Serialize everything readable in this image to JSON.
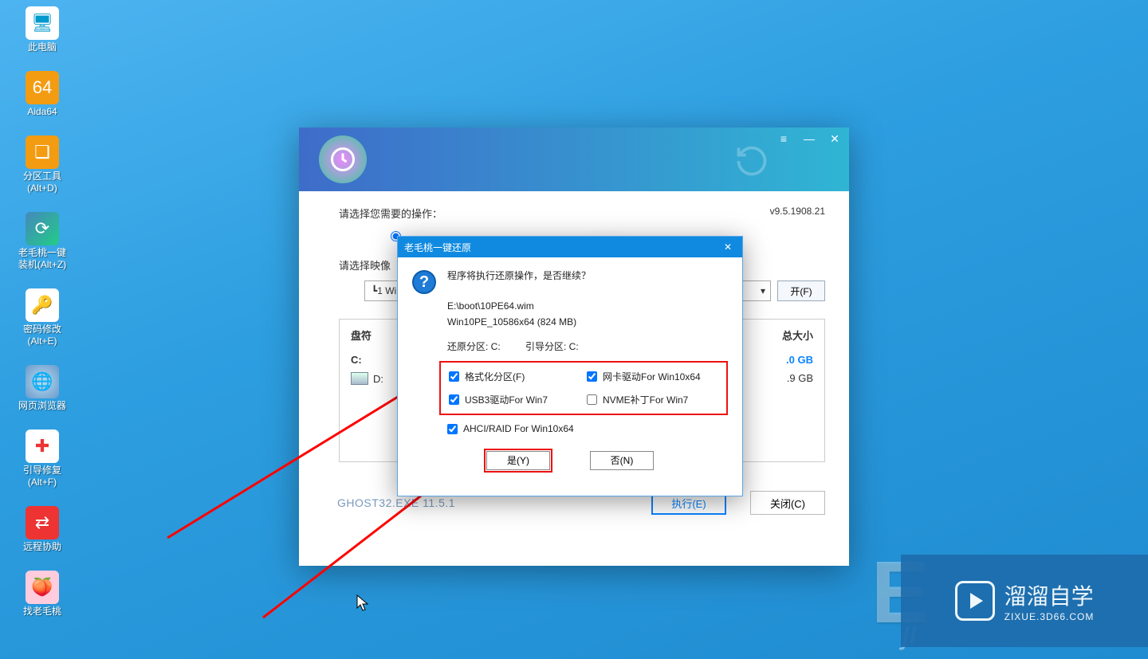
{
  "desktop_icons": [
    {
      "id": "this-pc",
      "label": "此电脑"
    },
    {
      "id": "aida64",
      "label": "Aida64"
    },
    {
      "id": "part-tool",
      "label": "分区工具\n(Alt+D)"
    },
    {
      "id": "lmt",
      "label": "老毛桃一键\n装机(Alt+Z)"
    },
    {
      "id": "pwd",
      "label": "密码修改\n(Alt+E)"
    },
    {
      "id": "browser",
      "label": "网页浏览器"
    },
    {
      "id": "boot-fix",
      "label": "引导修复\n(Alt+F)"
    },
    {
      "id": "remote",
      "label": "远程协助"
    },
    {
      "id": "find-lmt",
      "label": "找老毛桃"
    }
  ],
  "main": {
    "version": "v9.5.1908.21",
    "op_label": "请选择您需要的操作：",
    "img_label": "请选择映像",
    "combo_value": "┗1  Wi",
    "open_btn": "开(F)",
    "grid_head": {
      "c1": "盘符",
      "c2": "总大小"
    },
    "rows": [
      {
        "drive": "C:",
        "size": ".0 GB",
        "cls": "win",
        "active": true
      },
      {
        "drive": "D:",
        "size": ".9 GB",
        "cls": "",
        "active": false
      }
    ],
    "ghost": "GHOST32.EXE 11.5.1",
    "exec_btn": "执行(E)",
    "close_btn": "关闭(C)"
  },
  "dlg": {
    "title": "老毛桃一键还原",
    "q1": "程序将执行还原操作，是否继续？",
    "path": "E:\\boot\\10PE64.wim",
    "wim": "Win10PE_10586x64 (824 MB)",
    "part_c": "还原分区: C:",
    "boot_c": "引导分区: C:",
    "cb1": "格式化分区(F)",
    "cb2": "网卡驱动For Win10x64",
    "cb3": "USB3驱动For Win7",
    "cb4": "NVME补丁For Win7",
    "cb5": "AHCI/RAID For Win10x64",
    "yes": "是(Y)",
    "no": "否(N)"
  },
  "watermark": {
    "brand": "溜溜自学",
    "url": "ZIXUE.3D66.COM"
  }
}
